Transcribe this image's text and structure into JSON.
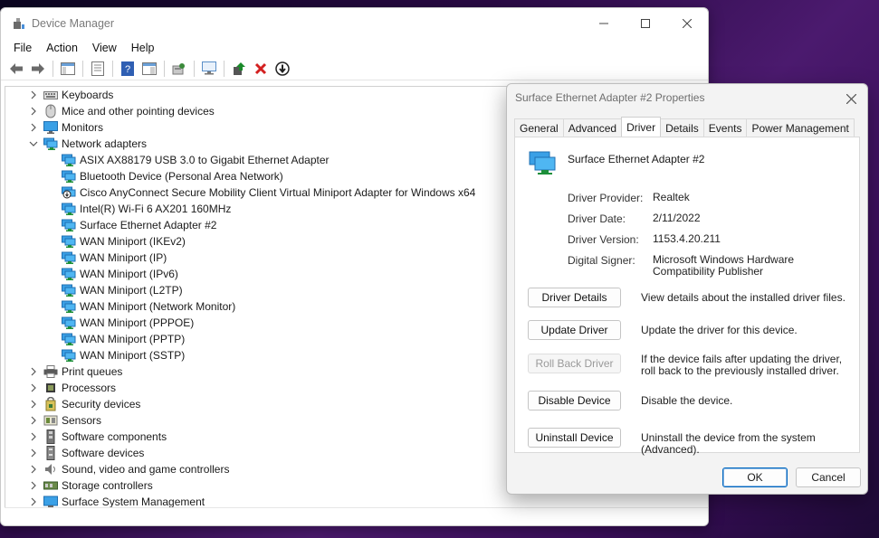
{
  "window": {
    "title": "Device Manager",
    "menu": [
      "File",
      "Action",
      "View",
      "Help"
    ]
  },
  "tree": [
    {
      "label": "Keyboards",
      "level": 0,
      "expanded": false,
      "icon": "keyboard-icon"
    },
    {
      "label": "Mice and other pointing devices",
      "level": 0,
      "expanded": false,
      "icon": "mouse-icon"
    },
    {
      "label": "Monitors",
      "level": 0,
      "expanded": false,
      "icon": "monitor-icon"
    },
    {
      "label": "Network adapters",
      "level": 0,
      "expanded": true,
      "icon": "network-adapter-icon"
    },
    {
      "label": "ASIX AX88179 USB 3.0 to Gigabit Ethernet Adapter",
      "level": 1,
      "icon": "network-adapter-icon"
    },
    {
      "label": "Bluetooth Device (Personal Area Network)",
      "level": 1,
      "icon": "network-adapter-icon"
    },
    {
      "label": "Cisco AnyConnect Secure Mobility Client Virtual Miniport Adapter for Windows x64",
      "level": 1,
      "icon": "network-adapter-disabled-icon"
    },
    {
      "label": "Intel(R) Wi-Fi 6 AX201 160MHz",
      "level": 1,
      "icon": "network-adapter-icon"
    },
    {
      "label": "Surface Ethernet Adapter #2",
      "level": 1,
      "icon": "network-adapter-icon"
    },
    {
      "label": "WAN Miniport (IKEv2)",
      "level": 1,
      "icon": "network-adapter-icon"
    },
    {
      "label": "WAN Miniport (IP)",
      "level": 1,
      "icon": "network-adapter-icon"
    },
    {
      "label": "WAN Miniport (IPv6)",
      "level": 1,
      "icon": "network-adapter-icon"
    },
    {
      "label": "WAN Miniport (L2TP)",
      "level": 1,
      "icon": "network-adapter-icon"
    },
    {
      "label": "WAN Miniport (Network Monitor)",
      "level": 1,
      "icon": "network-adapter-icon"
    },
    {
      "label": "WAN Miniport (PPPOE)",
      "level": 1,
      "icon": "network-adapter-icon"
    },
    {
      "label": "WAN Miniport (PPTP)",
      "level": 1,
      "icon": "network-adapter-icon"
    },
    {
      "label": "WAN Miniport (SSTP)",
      "level": 1,
      "icon": "network-adapter-icon"
    },
    {
      "label": "Print queues",
      "level": 0,
      "expanded": false,
      "icon": "printer-icon"
    },
    {
      "label": "Processors",
      "level": 0,
      "expanded": false,
      "icon": "processor-icon"
    },
    {
      "label": "Security devices",
      "level": 0,
      "expanded": false,
      "icon": "security-device-icon"
    },
    {
      "label": "Sensors",
      "level": 0,
      "expanded": false,
      "icon": "sensor-icon"
    },
    {
      "label": "Software components",
      "level": 0,
      "expanded": false,
      "icon": "software-component-icon"
    },
    {
      "label": "Software devices",
      "level": 0,
      "expanded": false,
      "icon": "software-device-icon"
    },
    {
      "label": "Sound, video and game controllers",
      "level": 0,
      "expanded": false,
      "icon": "speaker-icon"
    },
    {
      "label": "Storage controllers",
      "level": 0,
      "expanded": false,
      "icon": "storage-controller-icon"
    },
    {
      "label": "Surface System Management",
      "level": 0,
      "expanded": false,
      "icon": "system-management-icon"
    }
  ],
  "dialog": {
    "title": "Surface Ethernet Adapter #2 Properties",
    "tabs": [
      "General",
      "Advanced",
      "Driver",
      "Details",
      "Events",
      "Power Management"
    ],
    "active_tab": "Driver",
    "device_name": "Surface Ethernet Adapter #2",
    "props": {
      "provider_label": "Driver Provider:",
      "provider_value": "Realtek",
      "date_label": "Driver Date:",
      "date_value": "2/11/2022",
      "version_label": "Driver Version:",
      "version_value": "1153.4.20.211",
      "signer_label": "Digital Signer:",
      "signer_value": "Microsoft Windows Hardware Compatibility Publisher"
    },
    "actions": {
      "details_label": "Driver Details",
      "details_desc": "View details about the installed driver files.",
      "update_label": "Update Driver",
      "update_desc": "Update the driver for this device.",
      "rollback_label": "Roll Back Driver",
      "rollback_desc": "If the device fails after updating the driver, roll back to the previously installed driver.",
      "disable_label": "Disable Device",
      "disable_desc": "Disable the device.",
      "uninstall_label": "Uninstall Device",
      "uninstall_desc": "Uninstall the device from the system (Advanced)."
    },
    "ok_label": "OK",
    "cancel_label": "Cancel"
  },
  "colors": {
    "accent": "#0067c0",
    "close_x": "#d32020",
    "enable_green": "#1a8a2a"
  }
}
